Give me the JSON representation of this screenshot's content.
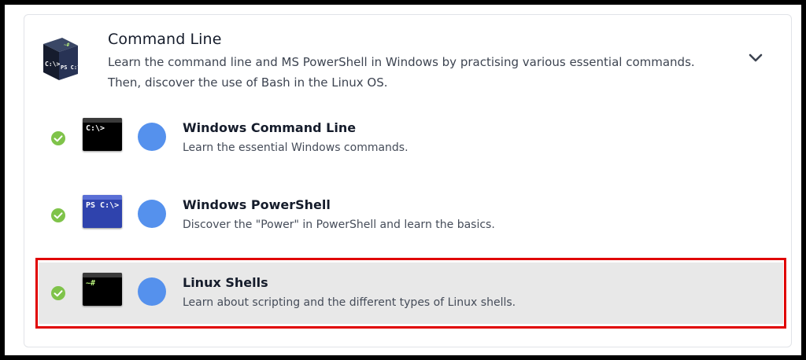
{
  "module": {
    "title": "Command Line",
    "description": "Learn the command line and MS PowerShell in Windows by practising various essential commands. Then, discover the use of Bash in the Linux OS.",
    "icon": "terminal-cube-icon",
    "icon_labels": [
      "C:\\>",
      "PS C:\\>",
      "~#"
    ]
  },
  "rooms": [
    {
      "title": "Windows Command Line",
      "description": "Learn the essential Windows commands.",
      "completed": true,
      "icon_text": "C:\\>",
      "icon_bg": "#000000"
    },
    {
      "title": "Windows PowerShell",
      "description": "Discover the \"Power\" in PowerShell and learn the basics.",
      "completed": true,
      "icon_text": "PS C:\\>",
      "icon_bg": "#2f43ad"
    },
    {
      "title": "Linux Shells",
      "description": "Learn about scripting and the different types of Linux shells.",
      "completed": true,
      "icon_text": "~#",
      "icon_bg": "#000000",
      "highlighted": true
    }
  ],
  "colors": {
    "check": "#7fc34a",
    "dot": "#5591ed",
    "highlight_border": "#e00000"
  }
}
